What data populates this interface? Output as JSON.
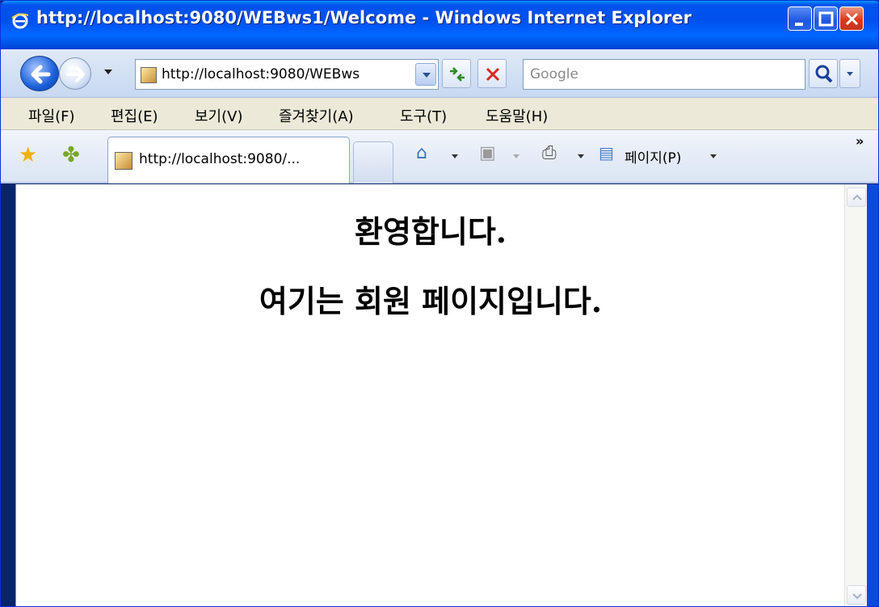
{
  "window": {
    "title": "http://localhost:9080/WEBws1/Welcome - Windows Internet Explorer"
  },
  "address": {
    "url": "http://localhost:9080/WEBws",
    "search_placeholder": "Google"
  },
  "menu": {
    "items": [
      "파일(F)",
      "편집(E)",
      "보기(V)",
      "즐겨찾기(A)",
      "도구(T)",
      "도움말(H)"
    ]
  },
  "tabs": {
    "active_label": "http://localhost:9080/..."
  },
  "commandbar": {
    "page_label": "페이지(P)"
  },
  "content": {
    "line1": "환영합니다.",
    "line2": "여기는 회원 페이지입니다."
  },
  "colors": {
    "titlebar": "#0055e5",
    "menubar": "#ece9d8",
    "close_button": "#d9391e"
  }
}
